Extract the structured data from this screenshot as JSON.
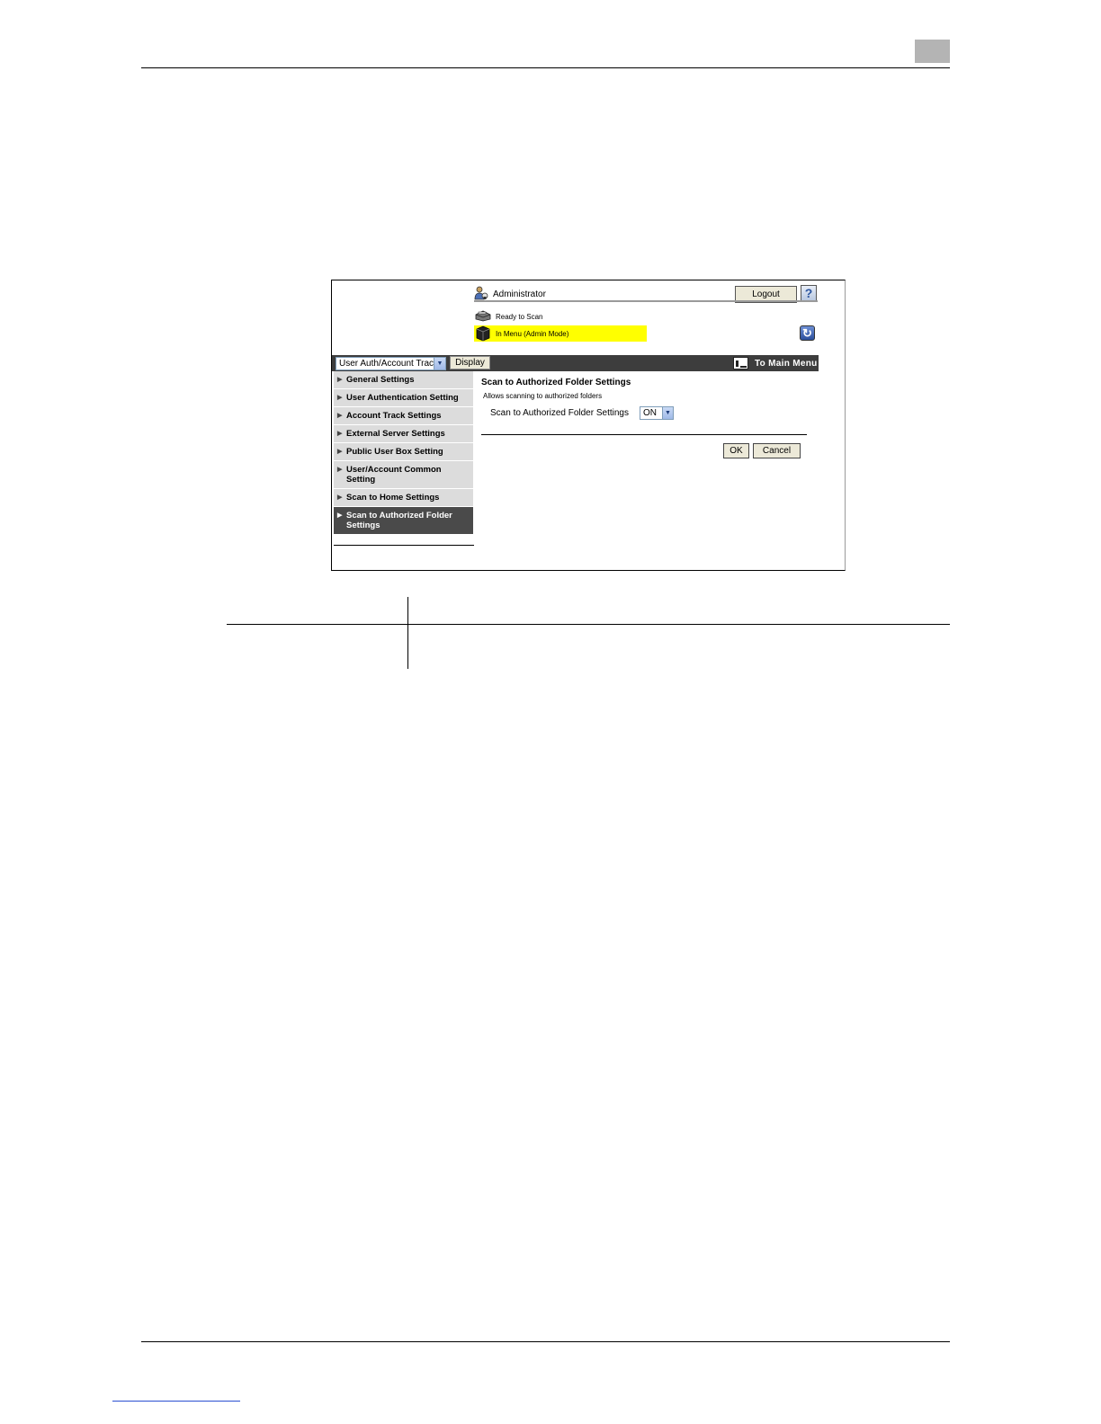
{
  "header": {
    "admin_label": "Administrator",
    "logout_label": "Logout",
    "help_label": "?"
  },
  "status": {
    "machine_status": "Ready to Scan",
    "mode_label": "In Menu (Admin Mode)"
  },
  "menu_bar": {
    "category_select_value": "User Auth/Account Track",
    "display_label": "Display",
    "to_main_menu_label": "To Main Menu"
  },
  "sidebar": {
    "items": [
      {
        "label": "General Settings",
        "active": false
      },
      {
        "label": "User Authentication Setting",
        "active": false
      },
      {
        "label": "Account Track Settings",
        "active": false
      },
      {
        "label": "External Server Settings",
        "active": false
      },
      {
        "label": "Public User Box Setting",
        "active": false
      },
      {
        "label": "User/Account Common Setting",
        "active": false
      },
      {
        "label": "Scan to Home Settings",
        "active": false
      },
      {
        "label": "Scan to Authorized Folder Settings",
        "active": true
      }
    ]
  },
  "main": {
    "title": "Scan to Authorized Folder Settings",
    "description": "Allows scanning to authorized folders",
    "setting_label": "Scan to Authorized Folder Settings",
    "setting_value": "ON",
    "ok_label": "OK",
    "cancel_label": "Cancel"
  },
  "icons": {
    "admin": "admin-user-icon",
    "help": "help-icon",
    "printer": "printer-icon",
    "machine": "machine-box-icon",
    "refresh": "refresh-icon",
    "main_menu": "main-menu-icon",
    "dropdown": "chevron-down-icon",
    "menu_arrow": "triangle-right-icon"
  },
  "colors": {
    "mode_highlight": "#ffff00",
    "menu_bar": "#3d3d3d",
    "active_item": "#4a4a4a",
    "sidebar_item": "#dcdcdc"
  }
}
